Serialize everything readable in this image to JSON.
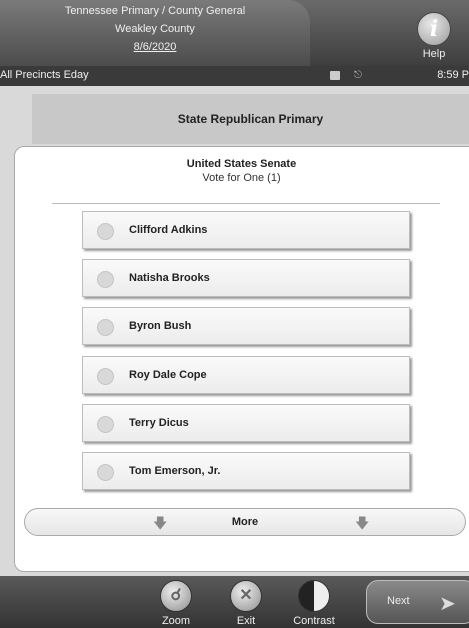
{
  "header": {
    "line1": "Tennessee Primary / County General",
    "line2": "Weakley County",
    "line3": "8/6/2020",
    "help_label": "Help",
    "help_glyph": "i"
  },
  "status": {
    "left": "All Precincts Eday",
    "time": "8:59 P"
  },
  "ballot": {
    "contest": "State Republican Primary",
    "race_title": "United States Senate",
    "vote_for": "Vote for One (1)",
    "candidates": [
      "Clifford Adkins",
      "Natisha Brooks",
      "Byron Bush",
      "Roy Dale Cope",
      "Terry Dicus",
      "Tom Emerson, Jr."
    ],
    "more_label": "More"
  },
  "footer": {
    "zoom": "Zoom",
    "exit": "Exit",
    "contrast": "Contrast",
    "next": "Next"
  },
  "icons": {
    "zoom": "magnifier-icon",
    "exit": "x-circle-icon",
    "contrast": "half-circle-icon",
    "next": "right-arrow-icon"
  }
}
